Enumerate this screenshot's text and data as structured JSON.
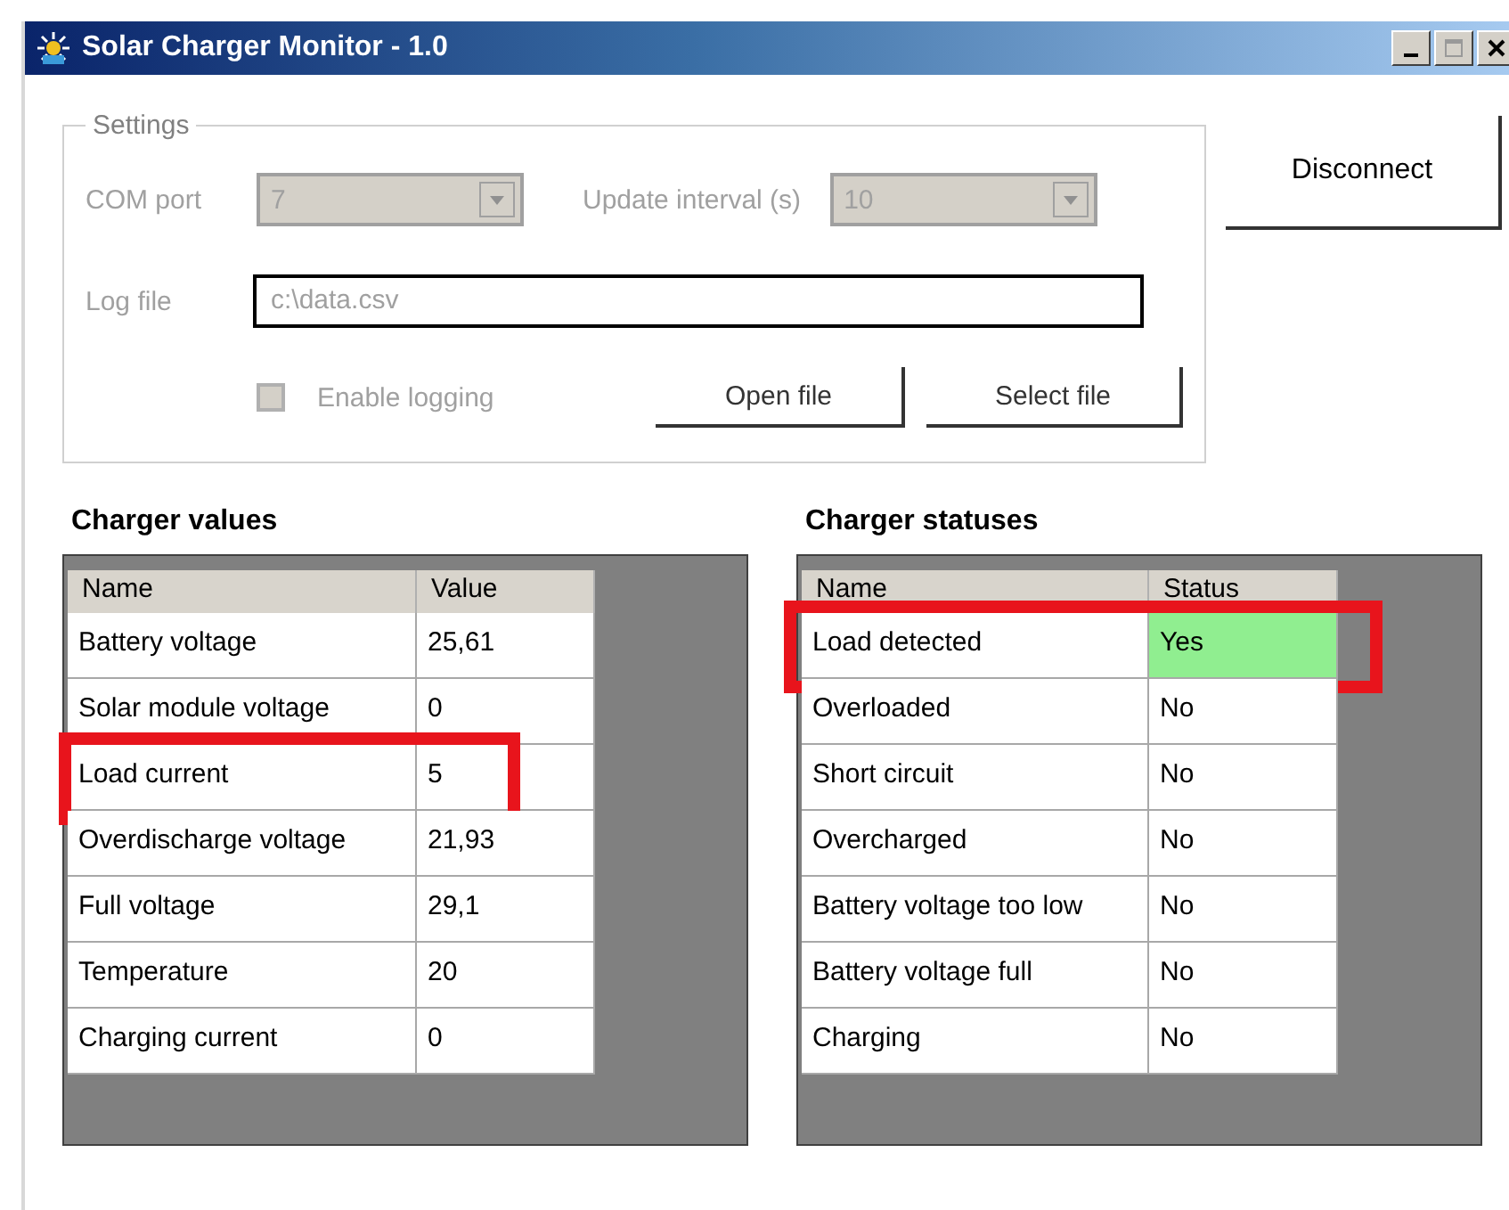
{
  "window": {
    "title": "Solar Charger Monitor - 1.0"
  },
  "settings": {
    "title": "Settings",
    "disabled": true,
    "com_port": {
      "label": "COM port",
      "value": "7"
    },
    "update_interval": {
      "label": "Update interval (s)",
      "value": "10"
    },
    "log_file": {
      "label": "Log file",
      "value": "c:\\data.csv"
    },
    "enable_logging": {
      "label": "Enable logging",
      "checked": false
    },
    "buttons": [
      "Open file",
      "Select file"
    ]
  },
  "disconnect_button": "Disconnect",
  "tables": [
    {
      "title": "Charger values",
      "columns": [
        "Name",
        "Value"
      ],
      "rows": [
        {
          "name": "Battery voltage",
          "value": "25,61",
          "highlighted": false,
          "color": "#ffffff"
        },
        {
          "name": "Solar module voltage",
          "value": "0",
          "highlighted": false,
          "color": "#ffffff"
        },
        {
          "name": "Load current",
          "value": "5",
          "highlighted": true,
          "color": "#ffffff"
        },
        {
          "name": "Overdischarge voltage",
          "value": "21,93",
          "highlighted": false,
          "color": "#ffffff"
        },
        {
          "name": "Full voltage",
          "value": "29,1",
          "highlighted": false,
          "color": "#ffffff"
        },
        {
          "name": "Temperature",
          "value": "20",
          "highlighted": false,
          "color": "#ffffff"
        },
        {
          "name": "Charging current",
          "value": "0",
          "highlighted": false,
          "color": "#ffffff"
        }
      ]
    },
    {
      "title": "Charger statuses",
      "columns": [
        "Name",
        "Status"
      ],
      "rows": [
        {
          "name": "Load detected",
          "value": "Yes",
          "highlighted": true,
          "color": "#90ee90"
        },
        {
          "name": "Overloaded",
          "value": "No",
          "highlighted": false,
          "color": "#ffffff"
        },
        {
          "name": "Short circuit",
          "value": "No",
          "highlighted": false,
          "color": "#ffffff"
        },
        {
          "name": "Overcharged",
          "value": "No",
          "highlighted": false,
          "color": "#ffffff"
        },
        {
          "name": "Battery voltage too low",
          "value": "No",
          "highlighted": false,
          "color": "#ffffff"
        },
        {
          "name": "Battery voltage full",
          "value": "No",
          "highlighted": false,
          "color": "#ffffff"
        },
        {
          "name": "Charging",
          "value": "No",
          "highlighted": false,
          "color": "#ffffff"
        }
      ]
    }
  ]
}
